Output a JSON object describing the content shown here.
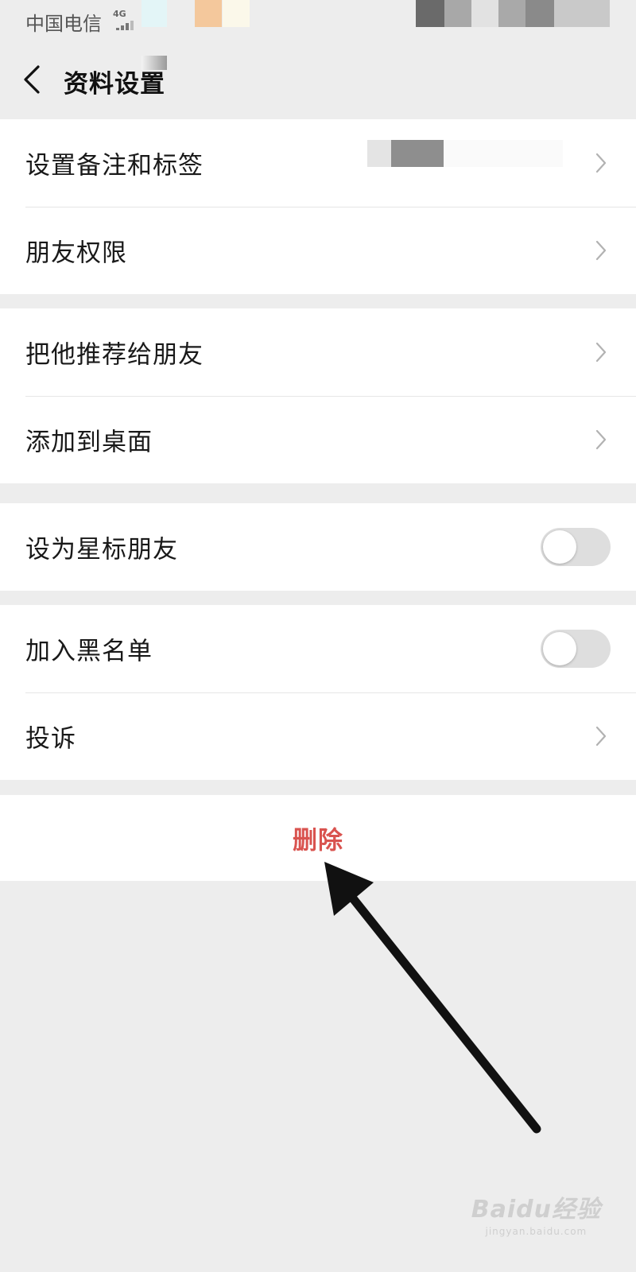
{
  "status_bar": {
    "carrier": "中国电信",
    "network": "4G"
  },
  "nav": {
    "title": "资料设置",
    "back_icon": "chevron-left-icon"
  },
  "groups": [
    {
      "items": [
        {
          "label": "设置备注和标签",
          "accessory": "chevron-right-icon"
        },
        {
          "label": "朋友权限",
          "accessory": "chevron-right-icon"
        }
      ]
    },
    {
      "items": [
        {
          "label": "把他推荐给朋友",
          "accessory": "chevron-right-icon"
        },
        {
          "label": "添加到桌面",
          "accessory": "chevron-right-icon"
        }
      ]
    },
    {
      "items": [
        {
          "label": "设为星标朋友",
          "accessory": "toggle",
          "toggle_on": false
        }
      ]
    },
    {
      "items": [
        {
          "label": "加入黑名单",
          "accessory": "toggle",
          "toggle_on": false
        },
        {
          "label": "投诉",
          "accessory": "chevron-right-icon"
        }
      ]
    }
  ],
  "delete": {
    "label": "删除",
    "color": "#d9534f"
  },
  "annotation": {
    "icon": "arrow-pointer-icon"
  },
  "watermark": {
    "main": "Baidu经验",
    "sub": "jingyan.baidu.com"
  },
  "colors": {
    "background": "#ededed",
    "cell": "#ffffff",
    "delete_text": "#d9534f"
  }
}
